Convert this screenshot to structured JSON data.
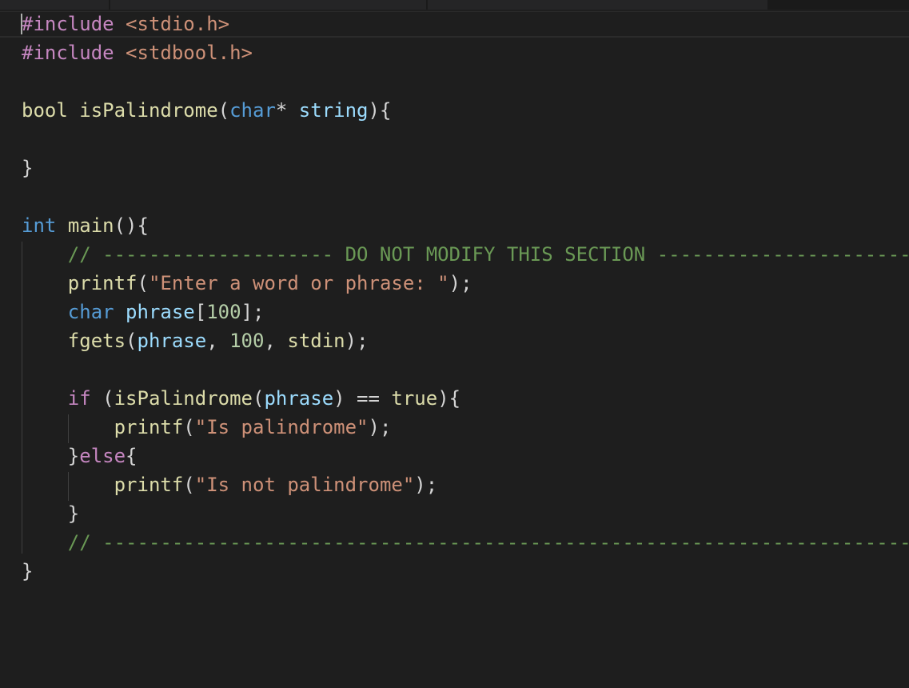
{
  "editor": {
    "theme_colors": {
      "background": "#1e1e1e",
      "keyword_preprocessor": "#c586c0",
      "keyword_type": "#569cd6",
      "string": "#ce9178",
      "function": "#dcdcaa",
      "variable": "#9cdcfe",
      "number": "#b5cea8",
      "comment": "#6a9955",
      "text": "#d4d4d4"
    },
    "lines": [
      {
        "t": [
          [
            "kw-pp",
            "#include"
          ],
          [
            "plain",
            " "
          ],
          [
            "str",
            "<stdio.h>"
          ]
        ]
      },
      {
        "t": [
          [
            "kw-pp",
            "#include"
          ],
          [
            "plain",
            " "
          ],
          [
            "str",
            "<stdbool.h>"
          ]
        ]
      },
      {
        "t": []
      },
      {
        "t": [
          [
            "fn",
            "bool"
          ],
          [
            "plain",
            " "
          ],
          [
            "fn",
            "isPalindrome"
          ],
          [
            "plain",
            "("
          ],
          [
            "kw-type",
            "char"
          ],
          [
            "plain",
            "* "
          ],
          [
            "var",
            "string"
          ],
          [
            "plain",
            "){"
          ]
        ]
      },
      {
        "t": []
      },
      {
        "t": [
          [
            "plain",
            "}"
          ]
        ]
      },
      {
        "t": []
      },
      {
        "t": [
          [
            "kw-type",
            "int"
          ],
          [
            "plain",
            " "
          ],
          [
            "fn",
            "main"
          ],
          [
            "plain",
            "(){"
          ]
        ]
      },
      {
        "t": [
          [
            "plain",
            "    "
          ],
          [
            "cmt",
            "// -------------------- DO NOT MODIFY THIS SECTION --------------------------"
          ]
        ]
      },
      {
        "t": [
          [
            "plain",
            "    "
          ],
          [
            "fn",
            "printf"
          ],
          [
            "plain",
            "("
          ],
          [
            "str",
            "\"Enter a word or phrase: \""
          ],
          [
            "plain",
            ");"
          ]
        ]
      },
      {
        "t": [
          [
            "plain",
            "    "
          ],
          [
            "kw-type",
            "char"
          ],
          [
            "plain",
            " "
          ],
          [
            "var",
            "phrase"
          ],
          [
            "plain",
            "["
          ],
          [
            "num",
            "100"
          ],
          [
            "plain",
            "];"
          ]
        ]
      },
      {
        "t": [
          [
            "plain",
            "    "
          ],
          [
            "fn",
            "fgets"
          ],
          [
            "plain",
            "("
          ],
          [
            "var",
            "phrase"
          ],
          [
            "plain",
            ", "
          ],
          [
            "num",
            "100"
          ],
          [
            "plain",
            ", "
          ],
          [
            "fn",
            "stdin"
          ],
          [
            "plain",
            ");"
          ]
        ]
      },
      {
        "t": []
      },
      {
        "t": [
          [
            "plain",
            "    "
          ],
          [
            "kw-ctrl",
            "if"
          ],
          [
            "plain",
            " ("
          ],
          [
            "fn",
            "isPalindrome"
          ],
          [
            "plain",
            "("
          ],
          [
            "var",
            "phrase"
          ],
          [
            "plain",
            ") == "
          ],
          [
            "fn",
            "true"
          ],
          [
            "plain",
            "){"
          ]
        ]
      },
      {
        "t": [
          [
            "plain",
            "        "
          ],
          [
            "fn",
            "printf"
          ],
          [
            "plain",
            "("
          ],
          [
            "str",
            "\"Is palindrome\""
          ],
          [
            "plain",
            ");"
          ]
        ]
      },
      {
        "t": [
          [
            "plain",
            "    }"
          ],
          [
            "kw-ctrl",
            "else"
          ],
          [
            "plain",
            "{"
          ]
        ]
      },
      {
        "t": [
          [
            "plain",
            "        "
          ],
          [
            "fn",
            "printf"
          ],
          [
            "plain",
            "("
          ],
          [
            "str",
            "\"Is not palindrome\""
          ],
          [
            "plain",
            ");"
          ]
        ]
      },
      {
        "t": [
          [
            "plain",
            "    }"
          ]
        ]
      },
      {
        "t": [
          [
            "plain",
            "    "
          ],
          [
            "cmt",
            "// ------------------------------------------------------------------------------"
          ]
        ]
      },
      {
        "t": [
          [
            "plain",
            "}"
          ]
        ]
      }
    ]
  }
}
